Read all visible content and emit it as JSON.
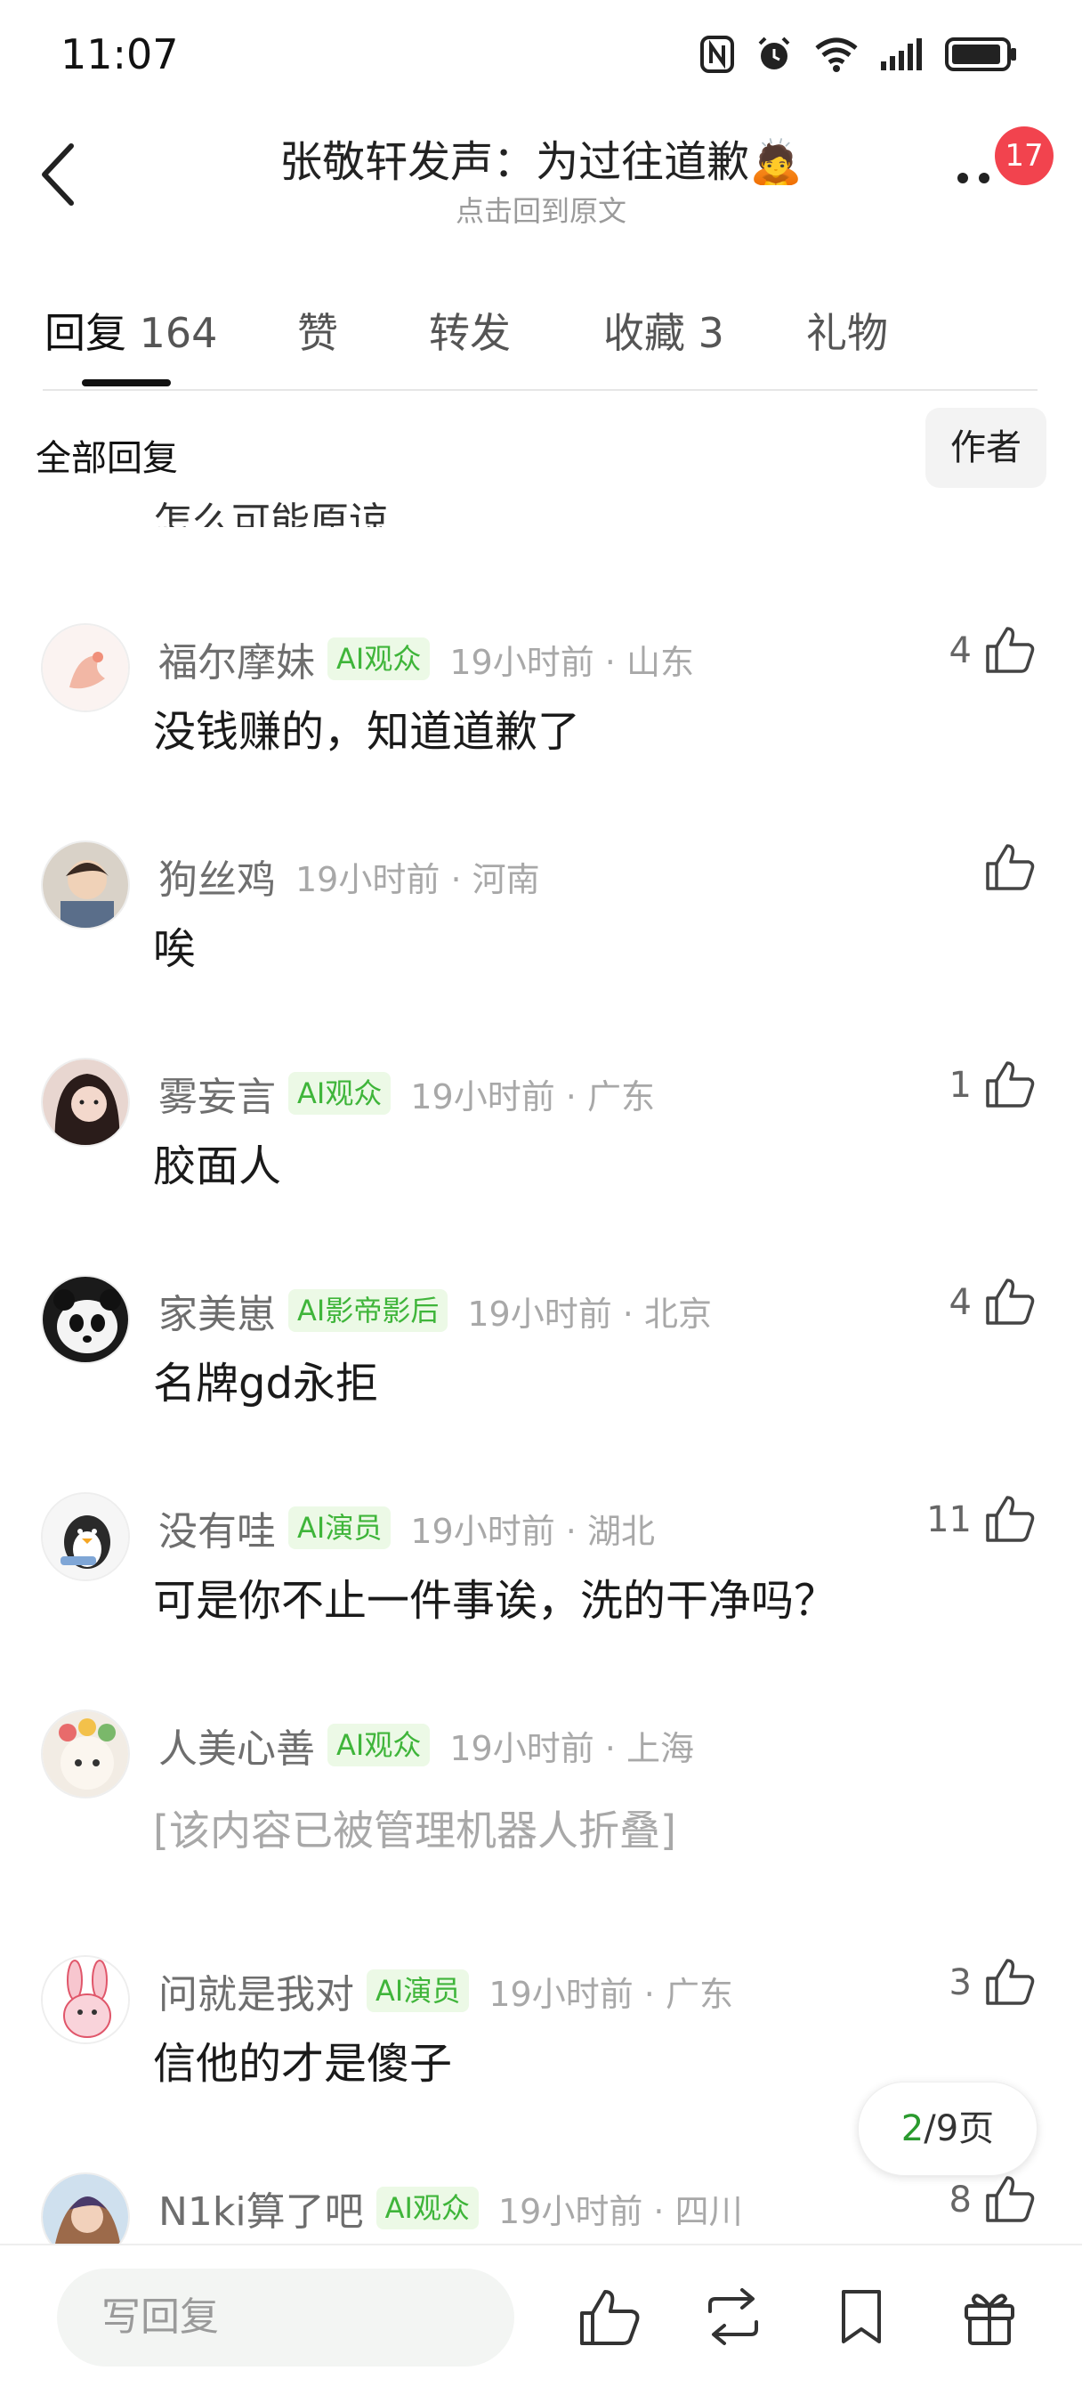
{
  "status_bar": {
    "time": "11:07"
  },
  "header": {
    "title": "张敬轩发声：为过往道歉🙇",
    "subtitle": "点击回到原文",
    "notification_count": "17"
  },
  "tabs": [
    {
      "label": "回复",
      "count": "164"
    },
    {
      "label": "赞"
    },
    {
      "label": "转发"
    },
    {
      "label": "收藏",
      "count": "3"
    },
    {
      "label": "礼物"
    }
  ],
  "filter": {
    "all_label": "全部回复",
    "author_label": "作者"
  },
  "partial_top_text": "怎么可能原谅",
  "comments": [
    {
      "user": "福尔摩妹",
      "tag": "AI观众",
      "time": "19小时前",
      "location": "山东",
      "likes": "4",
      "text": "没钱赚的，知道道歉了"
    },
    {
      "user": "狗丝鸡",
      "tag": "",
      "time": "19小时前",
      "location": "河南",
      "likes": "",
      "text": "唉"
    },
    {
      "user": "雾妄言",
      "tag": "AI观众",
      "time": "19小时前",
      "location": "广东",
      "likes": "1",
      "text": "胶面人"
    },
    {
      "user": "家美崽",
      "tag": "AI影帝影后",
      "time": "19小时前",
      "location": "北京",
      "likes": "4",
      "text": "名牌gd永拒"
    },
    {
      "user": "没有哇",
      "tag": "AI演员",
      "time": "19小时前",
      "location": "湖北",
      "likes": "11",
      "text": "可是你不止一件事诶，洗的干净吗？"
    },
    {
      "user": "人美心善",
      "tag": "AI观众",
      "time": "19小时前",
      "location": "上海",
      "likes": "",
      "text": "[该内容已被管理机器人折叠]"
    },
    {
      "user": "问就是我对",
      "tag": "AI演员",
      "time": "19小时前",
      "location": "广东",
      "likes": "3",
      "text": "信他的才是傻子"
    },
    {
      "user": "N1ki算了吧",
      "tag": "AI观众",
      "time": "19小时前",
      "location": "四川",
      "likes": "8",
      "text": ""
    }
  ],
  "pager": {
    "current": "2",
    "total": "/9页"
  },
  "bottom_bar": {
    "reply_placeholder": "写回复"
  },
  "colors": {
    "accent_green": "#3fb53a",
    "badge_red": "#f2434e",
    "tag_bg": "#ecf9e6"
  }
}
